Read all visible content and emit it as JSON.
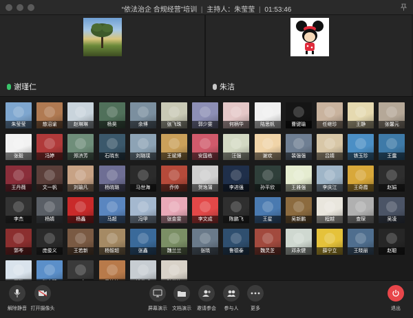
{
  "window": {
    "title": "“依法治企 合规经营”培训",
    "host_label": "主持人：朱莹莹",
    "timer": "01:53:46"
  },
  "speakers": [
    {
      "name": "谢瑾仁",
      "mic": "on",
      "image": "landscape-tree-photo"
    },
    {
      "name": "朱洁",
      "mic": "off",
      "image": "cartoon-mouse-avatar"
    }
  ],
  "participants": [
    {
      "name": "朱莹莹",
      "color": "#7ea6cf"
    },
    {
      "name": "慈沼谕",
      "color": "#b07a52"
    },
    {
      "name": "赵琳琳",
      "color": "#c9d4dc"
    },
    {
      "name": "杨昊",
      "color": "#50705a"
    },
    {
      "name": "余博",
      "color": "#7b8f9f"
    },
    {
      "name": "张飞珠",
      "color": "#c9c9b5"
    },
    {
      "name": "郭少雯",
      "color": "#8d8fb5"
    },
    {
      "name": "何柄华",
      "color": "#e4c7c7"
    },
    {
      "name": "陆思帆",
      "color": "#f0f0f0"
    },
    {
      "name": "曹键瑜",
      "color": "#151515"
    },
    {
      "name": "任继珍",
      "color": "#c9b39e"
    },
    {
      "name": "王静",
      "color": "#e5d9b0"
    },
    {
      "name": "张馨元",
      "color": "#b5a898"
    },
    {
      "name": "张毅",
      "color": "#f2f2f2"
    },
    {
      "name": "冯婷",
      "color": "#b03a3a"
    },
    {
      "name": "郑济芳",
      "color": "#6f8e7a"
    },
    {
      "name": "石晓东",
      "color": "#3b586b"
    },
    {
      "name": "刘璐璞",
      "color": "#8da3b5"
    },
    {
      "name": "王斌博",
      "color": "#caa05a"
    },
    {
      "name": "安国栋",
      "color": "#d05a6b"
    },
    {
      "name": "汪强",
      "color": "#d3d9c3"
    },
    {
      "name": "谢欢",
      "color": "#f0d4a8"
    },
    {
      "name": "裴强强",
      "color": "#6f7f93"
    },
    {
      "name": "吕婧",
      "color": "#d8c7a7"
    },
    {
      "name": "铁玉珍",
      "color": "#4b8fc5"
    },
    {
      "name": "王露",
      "color": "#3e7aa8"
    },
    {
      "name": "王丹薇",
      "color": "#8a2e3a"
    },
    {
      "name": "文一帆",
      "color": "#5b3f3a"
    },
    {
      "name": "刘瑜凡",
      "color": "#c7a285"
    },
    {
      "name": "杨晓璐",
      "color": "#6e6e94"
    },
    {
      "name": "马世海",
      "color": "#2b2b2b"
    },
    {
      "name": "乔帅",
      "color": "#b54a3a"
    },
    {
      "name": "贺逸蒲",
      "color": "#cfcfcf"
    },
    {
      "name": "李进强",
      "color": "#1f2f4a"
    },
    {
      "name": "孙平欣",
      "color": "#2f3f3a"
    },
    {
      "name": "王雅强",
      "color": "#e5ecd0"
    },
    {
      "name": "李庆江",
      "color": "#9fb5c7"
    },
    {
      "name": "王奇霞",
      "color": "#d8a83a"
    },
    {
      "name": "赵娟",
      "color": "#2e2e2e"
    },
    {
      "name": "李杰",
      "color": "#333333"
    },
    {
      "name": "杨婧",
      "color": "#5a5f66"
    },
    {
      "name": "杨鑫",
      "color": "#c92a2a"
    },
    {
      "name": "马超",
      "color": "#5a86c0"
    },
    {
      "name": "冯甲",
      "color": "#a4b8cf"
    },
    {
      "name": "张金雯",
      "color": "#e9a9b8"
    },
    {
      "name": "李文成",
      "color": "#e34848"
    },
    {
      "name": "陈鹏飞",
      "color": "#2f2f2f"
    },
    {
      "name": "王星",
      "color": "#4a7ab0"
    },
    {
      "name": "吴新鹏",
      "color": "#8c6b3f"
    },
    {
      "name": "程越",
      "color": "#e9e6dd"
    },
    {
      "name": "查琛",
      "color": "#b0b0b0"
    },
    {
      "name": "吴凌",
      "color": "#4b5466"
    },
    {
      "name": "郭岑",
      "color": "#8b2f2f"
    },
    {
      "name": "庞俊义",
      "color": "#2a2a2a"
    },
    {
      "name": "王若新",
      "color": "#7a5a43"
    },
    {
      "name": "杨智超",
      "color": "#a58a64"
    },
    {
      "name": "张鑫",
      "color": "#3a6a9a"
    },
    {
      "name": "魏兰兰",
      "color": "#7b8f65"
    },
    {
      "name": "张晓",
      "color": "#6a7a8a"
    },
    {
      "name": "鲁德泰",
      "color": "#2f4f6f"
    },
    {
      "name": "魏灵芝",
      "color": "#a24a3e"
    },
    {
      "name": "邓永健",
      "color": "#cfd8d0"
    },
    {
      "name": "薛宁立",
      "color": "#e5c23a"
    },
    {
      "name": "王晓丽",
      "color": "#4f6e8e"
    },
    {
      "name": "赵聪",
      "color": "#262626"
    },
    {
      "name": "王璐",
      "color": "#d9e3ec"
    },
    {
      "name": "张文臻",
      "color": "#5b8fc9"
    },
    {
      "name": "丁文",
      "color": "#3a3a3a"
    },
    {
      "name": "吴婷婷",
      "color": "#b87a4a"
    },
    {
      "name": "钱俊威",
      "color": "#c7cdd2"
    },
    {
      "name": "孙世涛",
      "color": "#d8d2c8"
    }
  ],
  "toolbar": {
    "mute": "解除静音",
    "camera": "打开摄像头",
    "share": "屏幕演示",
    "doc": "文档演示",
    "invite": "邀请参会",
    "members": "参与人",
    "more": "更多",
    "exit": "退出"
  },
  "colors": {
    "exit": "#e8464a",
    "mic_active": "#39c46a"
  }
}
